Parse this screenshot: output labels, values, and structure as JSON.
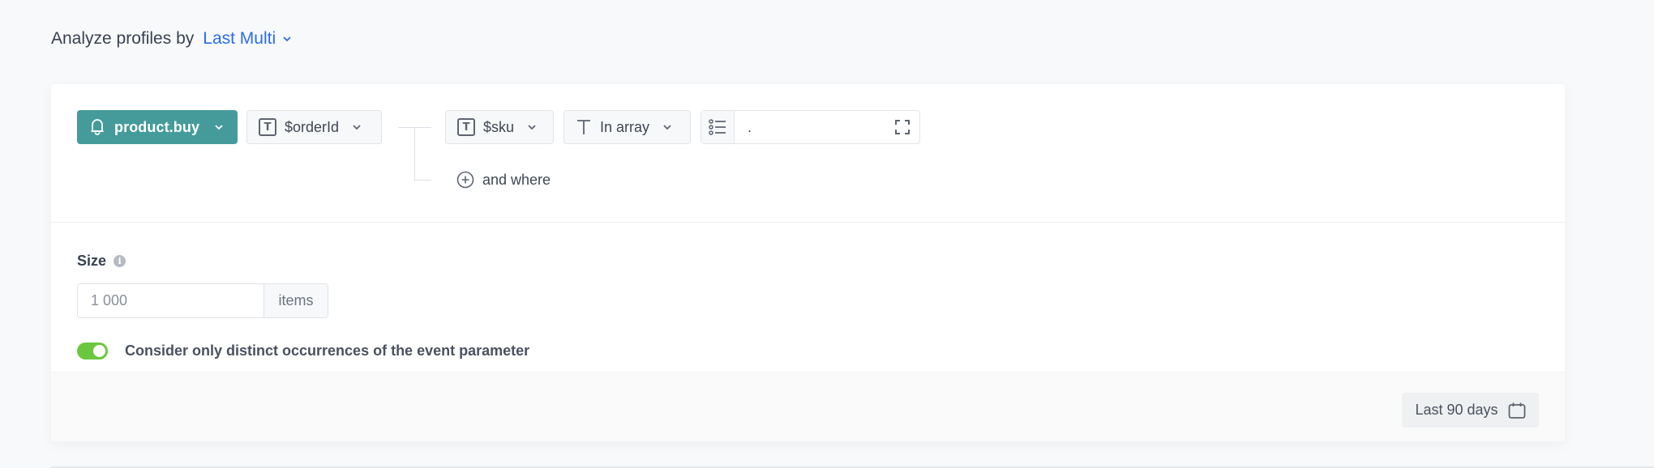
{
  "header": {
    "title": "Analyze profiles by",
    "selector_label": "Last Multi",
    "selector_icon": "chevron-down-icon"
  },
  "filter": {
    "event": {
      "label": "product.buy",
      "icon": "bell-icon"
    },
    "parameter": {
      "label": "$orderId",
      "type_icon": "text-type-icon"
    },
    "condition": {
      "attribute": {
        "label": "$sku",
        "type_icon": "text-type-icon"
      },
      "operator": {
        "label": "In array",
        "icon": "text-operator-icon"
      },
      "value": {
        "text": ".",
        "list_icon": "list-icon",
        "expand_icon": "expand-icon"
      }
    },
    "and_where_label": "and where"
  },
  "options": {
    "size_label": "Size",
    "size_info_icon": "info-icon",
    "size_value": "",
    "size_placeholder": "1 000",
    "size_unit": "items",
    "distinct_toggle": {
      "on": true,
      "label": "Consider only distinct occurrences of the event parameter"
    }
  },
  "footer": {
    "date_range_label": "Last 90 days",
    "date_icon": "calendar-icon"
  },
  "colors": {
    "accent": "#2c6cec",
    "event_button": "#459b9a",
    "toggle_on": "#6bc83e"
  }
}
